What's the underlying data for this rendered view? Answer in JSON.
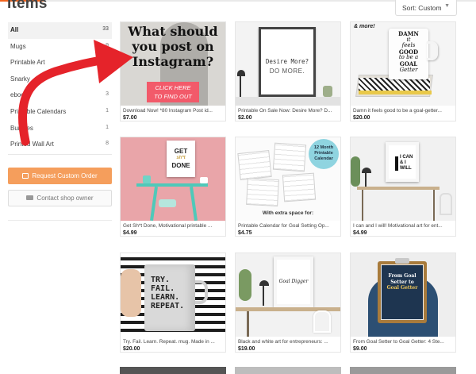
{
  "page": {
    "heading": "Items"
  },
  "sort": {
    "label": "Sort: Custom",
    "caret": "▼"
  },
  "sidebar": {
    "categories": [
      {
        "label": "All",
        "count": "33"
      },
      {
        "label": "Mugs",
        "count": "9"
      },
      {
        "label": "Printable Art",
        "count": ""
      },
      {
        "label": "Snarky",
        "count": ""
      },
      {
        "label": "ebooks",
        "count": "3"
      },
      {
        "label": "Printable Calendars",
        "count": "1"
      },
      {
        "label": "Bundles",
        "count": "1"
      },
      {
        "label": "Printed Wall Art",
        "count": "8"
      }
    ],
    "request_button": "Request Custom Order",
    "contact_button": "Contact shop owner"
  },
  "products": [
    {
      "title": "Download Now! *80 Instagram Post id...",
      "price": "$7.00",
      "art": {
        "line1": "What should",
        "line2": "you post on",
        "line3": "Instagram?",
        "cta1": "CLICK HERE",
        "cta2": "TO FIND OUT"
      }
    },
    {
      "title": "Printable On Sale Now: Desire More? D...",
      "price": "$2.00",
      "art": {
        "line1": "Desire More?",
        "line2": "DO MORE."
      }
    },
    {
      "title": "Damn it feels good to be a goal-getter...",
      "price": "$20.00",
      "art": {
        "corner": "& more!",
        "line1": "DAMN",
        "line2": "it",
        "line3": "feels",
        "line4": "GOOD",
        "line5": "to be a",
        "line6": "GOAL",
        "line7": "Getter"
      }
    },
    {
      "title": "Get Sh*t Done, Motivational printable ...",
      "price": "$4.99",
      "art": {
        "line1": "GET",
        "line2": "sh*t",
        "line3": "DONE"
      }
    },
    {
      "title": "Printable Calendar for Goal Setting Op...",
      "price": "$4.75",
      "art": {
        "badge1": "12 Month",
        "badge2": "Printable",
        "badge3": "Calendar",
        "footer": "With extra space for:"
      }
    },
    {
      "title": "I can and I will! Motivational art for ent...",
      "price": "$4.99",
      "art": {
        "line1": "I CAN",
        "line2": "& I",
        "line3": "WILL"
      }
    },
    {
      "title": "Try. Fail. Learn. Repeat. mug. Made in ...",
      "price": "$20.00",
      "art": {
        "line1": "TRY.",
        "line2": "FAIL.",
        "line3": "LEARN.",
        "line4": "REPEAT."
      }
    },
    {
      "title": "Black and white art for entrepreneurs: ...",
      "price": "$19.00",
      "art": {
        "line1": "Goal Digger"
      }
    },
    {
      "title": "From Goal Setter to Goal Getter: 4 Ste...",
      "price": "$9.00",
      "art": {
        "line1": "From Goal",
        "line2": "Setter to",
        "line3": "Goal Getter"
      }
    }
  ],
  "colors": {
    "accent": "#f1641e",
    "request_button": "#f59e5c",
    "annotation_arrow": "#e5232a",
    "cta_pink": "#f25a6a",
    "calendar_blue": "#8fd4e0"
  },
  "icons": {
    "annotation": "red-curved-arrow",
    "request": "envelope-icon",
    "contact": "chat-icon"
  }
}
